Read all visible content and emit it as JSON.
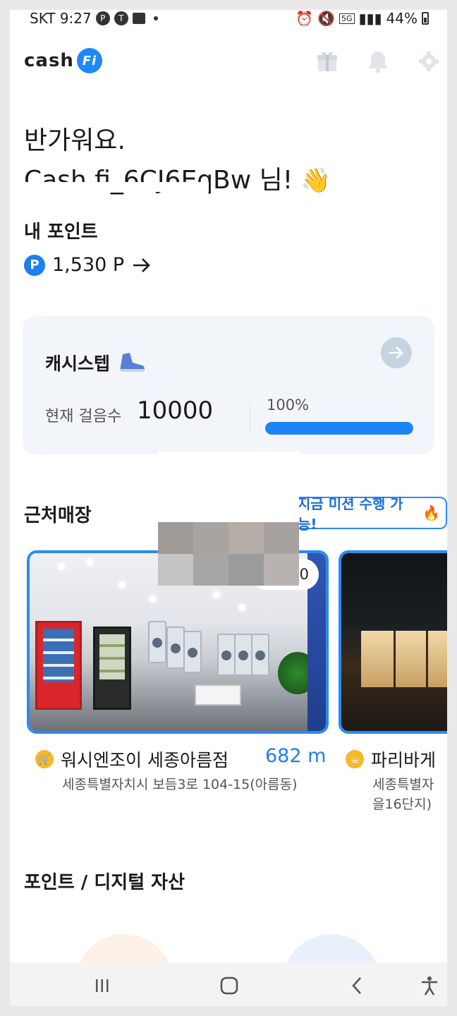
{
  "status_bar": {
    "carrier_time": "SKT 9:27",
    "network": "5G",
    "battery": "44%"
  },
  "header": {
    "logo_text": "cash",
    "logo_badge": "Fi"
  },
  "greeting": {
    "line1": "반가워요.",
    "line2_name": "Cash.fi_6CJ6EqBw",
    "line2_suffix": "님!"
  },
  "points": {
    "title": "내 포인트",
    "coin_symbol": "P",
    "value": "1,530 P"
  },
  "cashstep": {
    "title": "캐시스텝",
    "steps_label": "현재 걸음수",
    "steps_value": "10000",
    "percent_label": "100%",
    "progress_fraction": 1.0
  },
  "nearby": {
    "title": "근처매장",
    "mission_badge": "지금 미션 수행 가능!",
    "stores": [
      {
        "name": "워시엔조이 세종아름점",
        "distance": "682 m",
        "address": "세종특별자치시 보듬3로 104-15(아름동)",
        "point_badge": "100"
      },
      {
        "name": "파리바게",
        "address_line1": "세종특별자",
        "address_line2": "을16단지)"
      }
    ]
  },
  "assets": {
    "title": "포인트 / 디지털 자산"
  },
  "colors": {
    "accent": "#1e83f4",
    "card_bg": "#f2f6fb"
  }
}
